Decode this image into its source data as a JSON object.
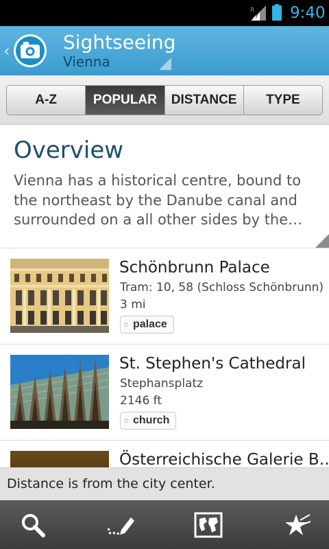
{
  "status_bar": {
    "time": "9:40",
    "network_indicator": "R"
  },
  "action_bar": {
    "title": "Sightseeing",
    "subtitle": "Vienna",
    "app_icon": "camera-icon"
  },
  "tabs": [
    {
      "label": "A-Z",
      "active": false
    },
    {
      "label": "POPULAR",
      "active": true
    },
    {
      "label": "DISTANCE",
      "active": false
    },
    {
      "label": "TYPE",
      "active": false
    }
  ],
  "overview": {
    "heading": "Overview",
    "text": "Vienna has a historical centre, bound to the northeast by the Danube canal and surrounded on a all other sides by the…"
  },
  "places": [
    {
      "name": "Schönbrunn Palace",
      "line2": "Tram: 10, 58 (Schloss Schönbrunn)",
      "distance": "3 mi",
      "tag": "palace"
    },
    {
      "name": "St. Stephen's Cathedral",
      "line2": "Stephansplatz",
      "distance": "2146 ft",
      "tag": "church"
    },
    {
      "name": "Österreichische Galerie B…"
    }
  ],
  "info_bar": {
    "message": "Distance is from the city center."
  },
  "bottom_bar": {
    "icons": [
      "search-icon",
      "edit-icon",
      "map-icon",
      "favorites-icon"
    ]
  },
  "colors": {
    "accent": "#33b5e5",
    "action_bar": "#4ea8d8",
    "heading": "#1b4f6b"
  }
}
